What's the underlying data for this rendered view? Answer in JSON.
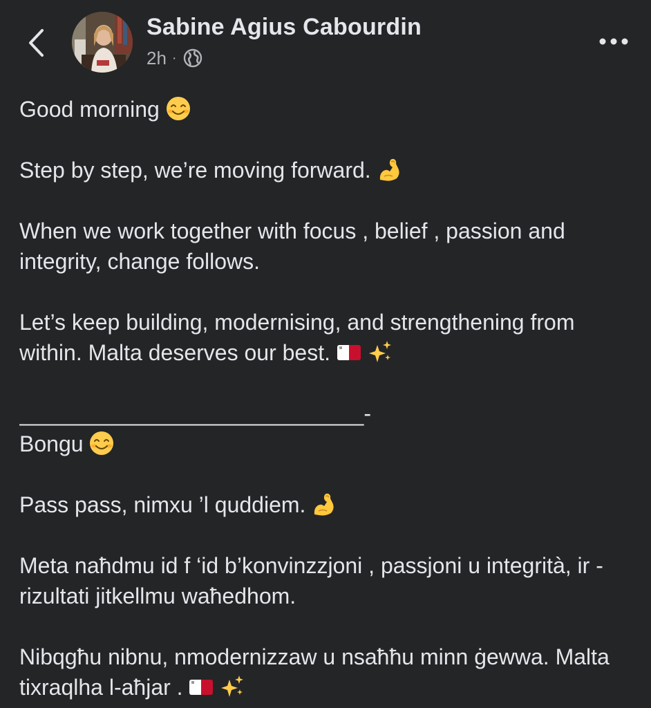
{
  "header": {
    "author_name": "Sabine Agius Cabourdin",
    "time": "2h",
    "separator": "·",
    "privacy_icon": "globe-icon",
    "back_icon": "chevron-left-icon",
    "more_icon": "more-horizontal-icon"
  },
  "post": {
    "en_greeting": "Good morning",
    "en_line1": "Step by step, we’re moving forward.",
    "en_line2": "When we work together with focus , belief , passion and integrity, change follows.",
    "en_line3": "Let’s keep building, modernising, and strengthening from within. Malta deserves our best.",
    "divider": "____________________________-",
    "mt_greeting": "Bongu",
    "mt_line1": "Pass pass, nimxu ’l quddiem.",
    "mt_line2": "Meta naħdmu id f ‘id b’konvinzzjoni , passjoni u integrità, ir - rizultati jitkellmu waħedhom.",
    "mt_line3": "Nibqgħu nibnu, nmodernizzaw u nsaħħu minn ġewwa. Malta tixraqlha l-aħjar ."
  },
  "colors": {
    "background": "#242526",
    "text_primary": "#e4e6eb",
    "text_secondary": "#b0b3b8"
  },
  "emojis": [
    "smiling-face-emoji",
    "flexed-biceps-emoji",
    "malta-flag-emoji",
    "sparkles-emoji"
  ]
}
